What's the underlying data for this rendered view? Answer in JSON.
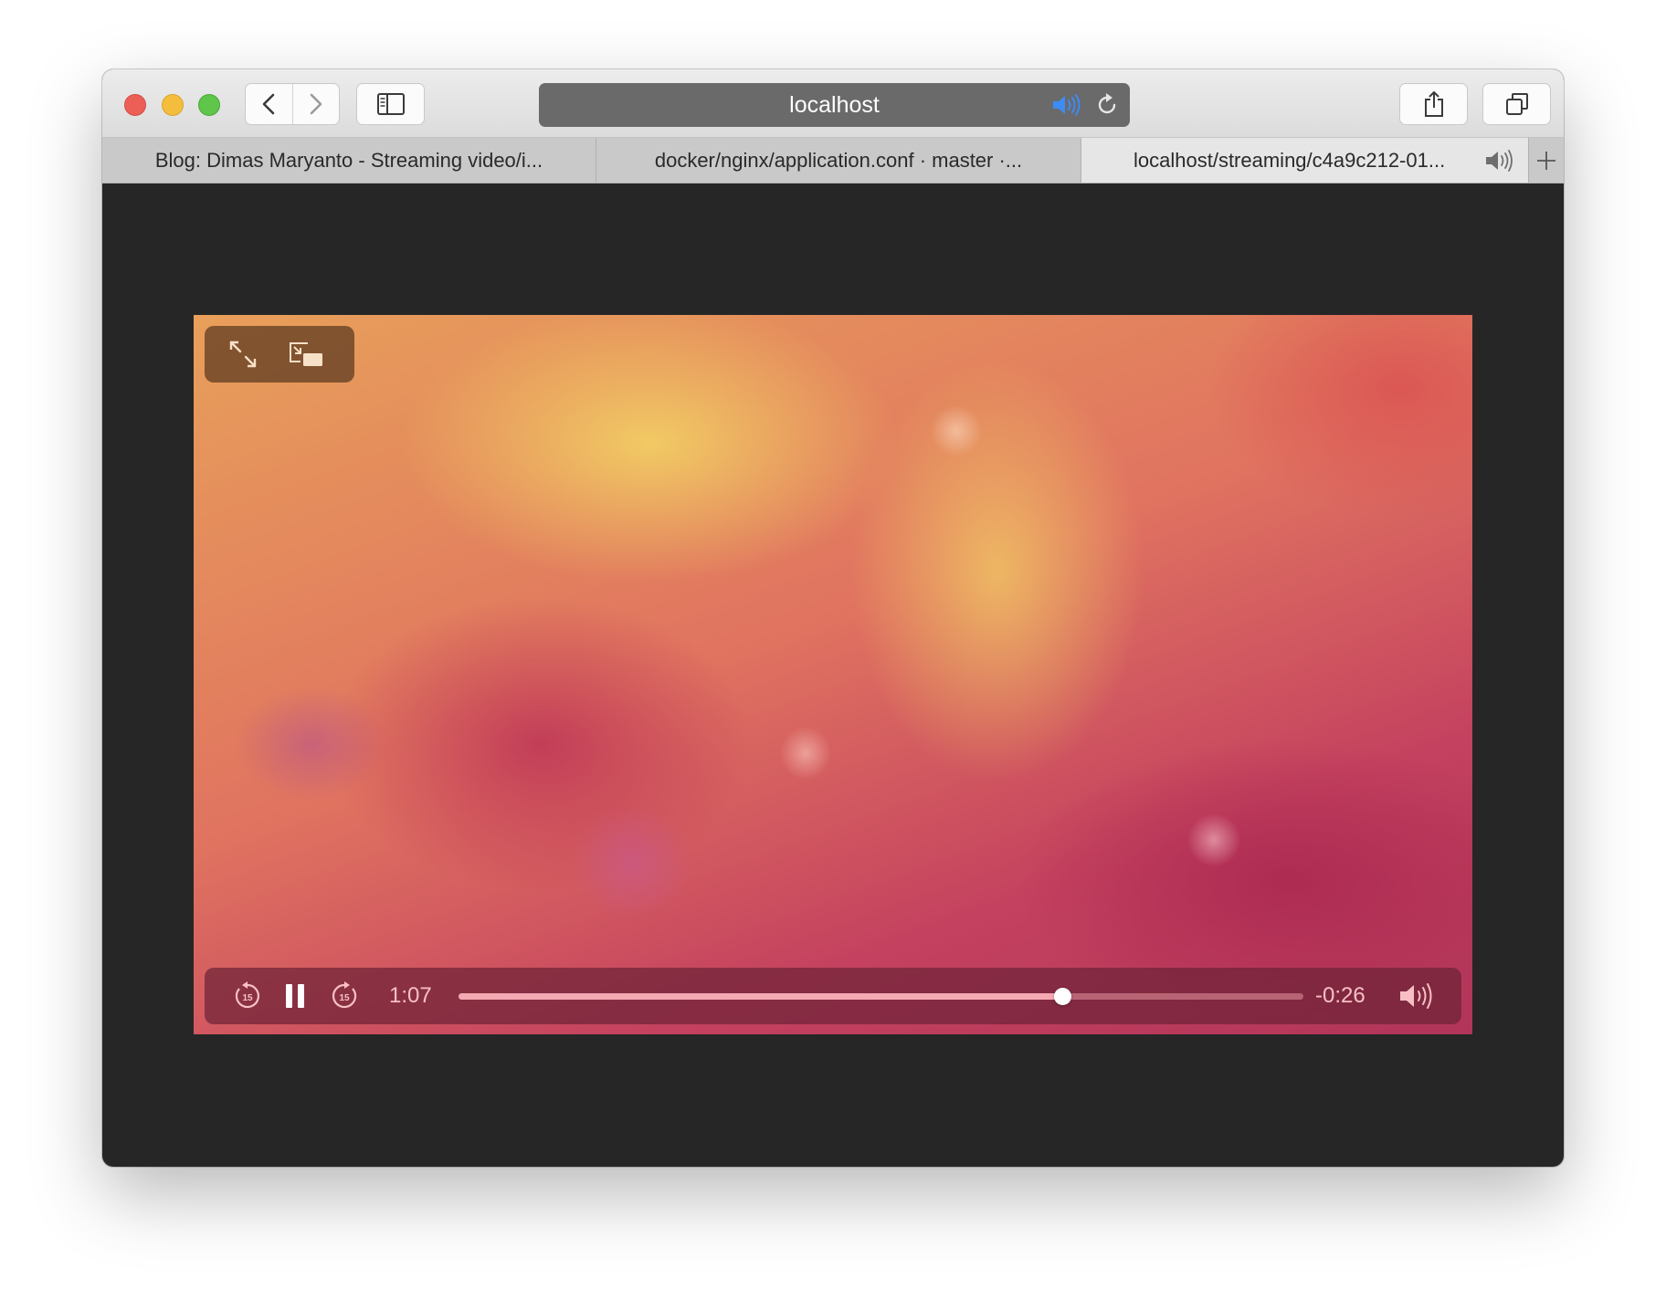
{
  "window": {
    "address": "localhost"
  },
  "tabs": [
    {
      "title": "Blog: Dimas Maryanto - Streaming video/i...",
      "active": false
    },
    {
      "title": "docker/nginx/application.conf · master ·...",
      "active": false
    },
    {
      "title": "localhost/streaming/c4a9c212-01...",
      "active": true,
      "audio_playing": true
    }
  ],
  "toolbar": {
    "icons": [
      "back-icon",
      "forward-icon",
      "sidebar-icon",
      "speaker-icon",
      "reload-icon",
      "share-icon",
      "tabs-overview-icon"
    ]
  },
  "player": {
    "elapsed": "1:07",
    "remaining": "-0:26",
    "progress": 0.715,
    "state": "playing",
    "skip_seconds_label": "15",
    "top_controls": [
      "fullscreen-icon",
      "picture-in-picture-icon"
    ],
    "bottom_controls": [
      "skip-back-15-icon",
      "pause-icon",
      "skip-forward-15-icon",
      "volume-icon"
    ]
  },
  "colors": {
    "address_speaker": "#3d8bf5",
    "time_text": "#f8c0c4",
    "progress_fill": "#f4a9b3"
  }
}
